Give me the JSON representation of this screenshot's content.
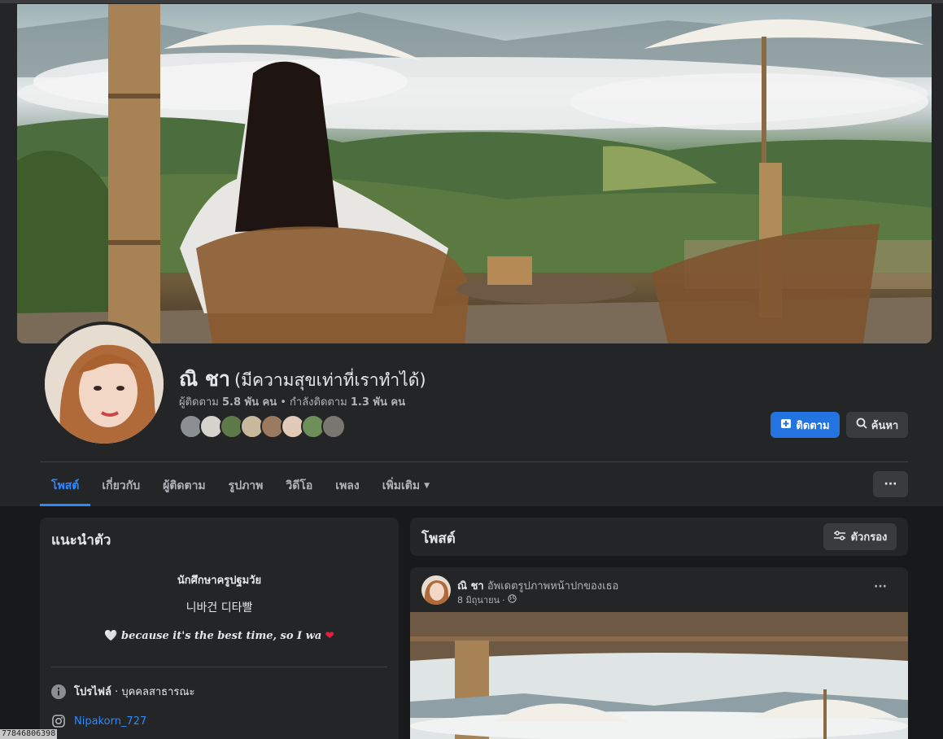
{
  "profile": {
    "name": "ณิ ชา",
    "nickname": "(มีความสุขเท่าที่เราทำได้)",
    "followers_label": "ผู้ติดตาม",
    "followers_count": "5.8 พัน คน",
    "following_label": "กำลังติดตาม",
    "following_count": "1.3 พัน คน",
    "separator": " • "
  },
  "actions": {
    "follow_label": "ติดตาม",
    "search_label": "ค้นหา"
  },
  "tabs": [
    {
      "label": "โพสต์"
    },
    {
      "label": "เกี่ยวกับ"
    },
    {
      "label": "ผู้ติดตาม"
    },
    {
      "label": "รูปภาพ"
    },
    {
      "label": "วิดีโอ"
    },
    {
      "label": "เพลง"
    },
    {
      "label": "เพิ่มเติม"
    }
  ],
  "more_dots": "···",
  "intro": {
    "title": "แนะนำตัว",
    "bio_line1": "นักศึกษาครูปฐมวัย",
    "bio_line2": "니바건 디타빨",
    "bio_line3": "because it's the best time, so I wa",
    "profile_label": "โปรไฟล์",
    "profile_type": " · บุคคลสาธารณะ",
    "instagram": "Nipakorn_727"
  },
  "posts_header": {
    "title": "โพสต์",
    "filter_label": "ตัวกรอง"
  },
  "post": {
    "author": "ณิ ชา",
    "action": " อัพเดตรูปภาพหน้าปกของเธอ",
    "date": "8 มิถุนายน",
    "dot": " · ",
    "menu": "···"
  },
  "watermark": "77846806398",
  "colors": {
    "accent": "#2d88ff",
    "follow_button": "#2374e1",
    "surface": "#242526",
    "background": "#18191a"
  }
}
